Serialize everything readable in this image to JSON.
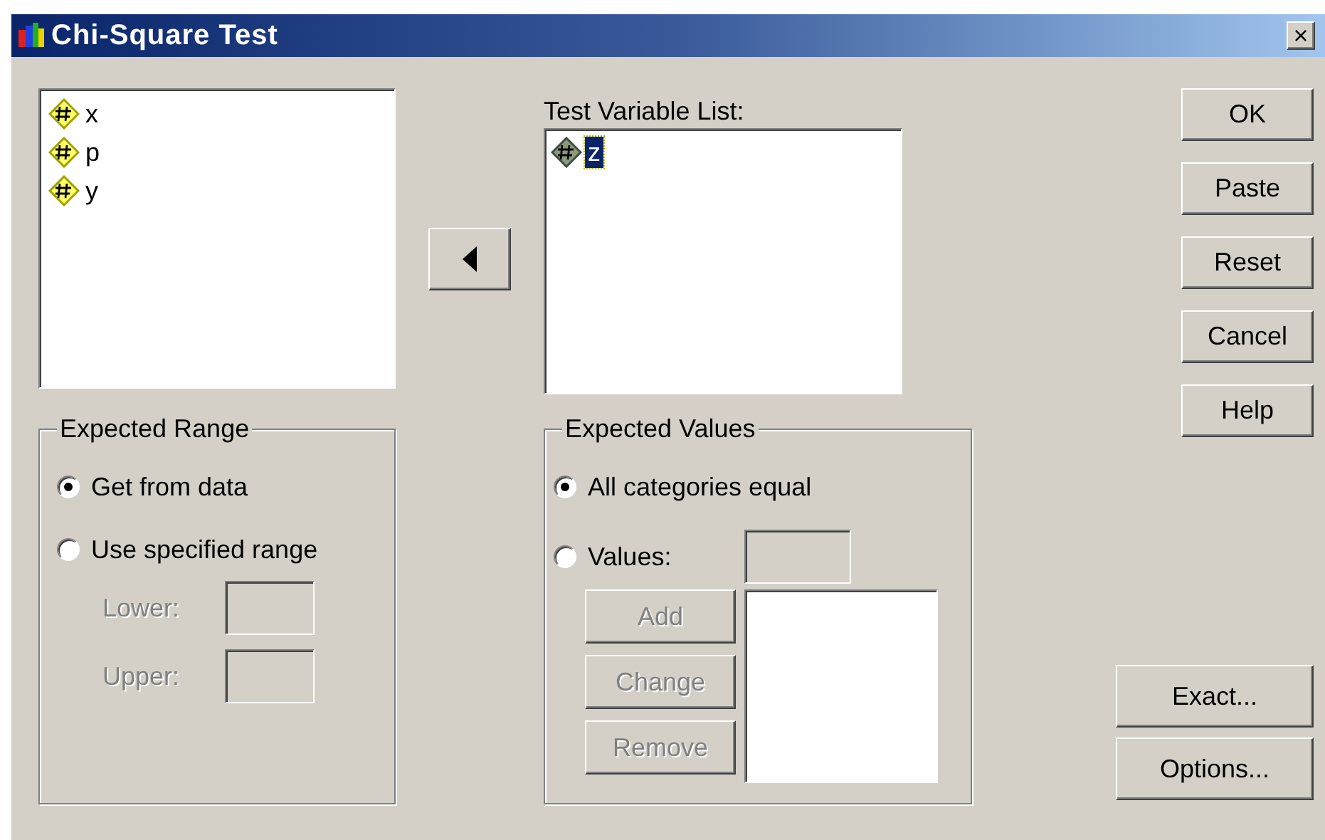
{
  "window": {
    "title": "Chi-Square Test",
    "close": "×"
  },
  "source_list": {
    "items": [
      {
        "name": "x",
        "selected": false
      },
      {
        "name": "p",
        "selected": false
      },
      {
        "name": "y",
        "selected": false
      }
    ]
  },
  "test_variable_list": {
    "label": "Test Variable List:",
    "items": [
      {
        "name": "z",
        "selected": true
      }
    ]
  },
  "buttons": [
    {
      "label": "OK",
      "disabled": false
    },
    {
      "label": "Paste",
      "disabled": false
    },
    {
      "label": "Reset",
      "disabled": false
    },
    {
      "label": "Cancel",
      "disabled": false
    },
    {
      "label": "Help",
      "disabled": false
    }
  ],
  "extra_buttons": [
    {
      "label": "Exact...",
      "disabled": false
    },
    {
      "label": "Options...",
      "disabled": false
    }
  ],
  "expected_range": {
    "title": "Expected Range",
    "options": [
      {
        "label": "Get from data",
        "selected": true
      },
      {
        "label": "Use specified range",
        "selected": false
      }
    ],
    "fields": [
      {
        "label": "Lower:",
        "disabled": true
      },
      {
        "label": "Upper:",
        "disabled": true
      }
    ]
  },
  "expected_values": {
    "title": "Expected Values",
    "options": [
      {
        "label": "All categories equal",
        "selected": true
      },
      {
        "label": "Values:",
        "selected": false
      }
    ],
    "buttons": [
      {
        "label": "Add",
        "disabled": true
      },
      {
        "label": "Change",
        "disabled": true
      },
      {
        "label": "Remove",
        "disabled": true
      }
    ]
  }
}
